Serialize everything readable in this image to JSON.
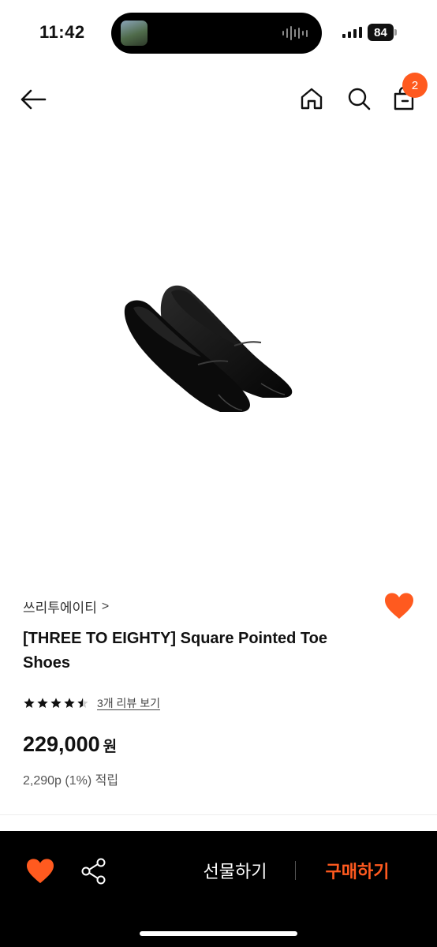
{
  "status_bar": {
    "time": "11:42",
    "battery": "84"
  },
  "nav": {
    "cart_count": "2",
    "icons": [
      "back-arrow-icon",
      "home-icon",
      "search-icon",
      "cart-icon"
    ]
  },
  "product": {
    "brand": "쓰리투에이티",
    "brand_chevron": ">",
    "title": "[THREE TO EIGHTY] Square Pointed Toe Shoes",
    "rating": 4.5,
    "review_link": "3개 리뷰 보기",
    "price": "229,000",
    "currency": "원",
    "points": "2,290p (1%) 적립"
  },
  "bottom_bar": {
    "gift_label": "선물하기",
    "buy_label": "구매하기"
  },
  "colors": {
    "accent": "#ff5a1f",
    "bar_bg": "#000000"
  }
}
